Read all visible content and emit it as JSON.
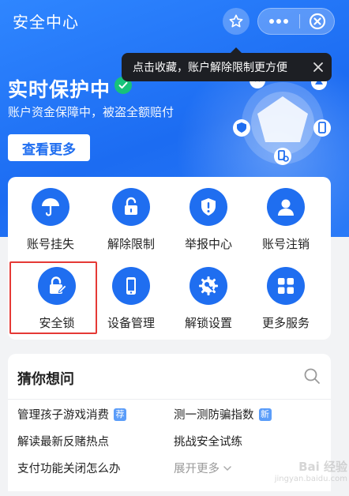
{
  "header": {
    "title": "安全中心",
    "tooltip": "点击收藏，账户解除限制更方便"
  },
  "hero": {
    "title": "实时保护中",
    "subtitle": "账户资金保障中，被盗全额赔付",
    "more_button": "查看更多"
  },
  "grid": [
    {
      "label": "账号挂失",
      "icon": "umbrella-icon"
    },
    {
      "label": "解除限制",
      "icon": "unlock-icon"
    },
    {
      "label": "举报中心",
      "icon": "alert-shield-icon"
    },
    {
      "label": "账号注销",
      "icon": "user-icon"
    },
    {
      "label": "安全锁",
      "icon": "lock-edit-icon"
    },
    {
      "label": "设备管理",
      "icon": "phone-icon"
    },
    {
      "label": "解锁设置",
      "icon": "gear-key-icon"
    },
    {
      "label": "更多服务",
      "icon": "apps-grid-icon"
    }
  ],
  "faq": {
    "title": "猜你想问",
    "items": [
      {
        "text": "管理孩子游戏消费",
        "badge": "荐"
      },
      {
        "text": "测一测防骗指数",
        "badge": "新"
      },
      {
        "text": "解读最新反赌热点"
      },
      {
        "text": "挑战安全试练"
      },
      {
        "text": "支付功能关闭怎么办"
      },
      {
        "text": "展开更多"
      }
    ]
  },
  "watermark": {
    "text": "Bai 经验",
    "url": "jingyan.baidu.com"
  },
  "colors": {
    "primary": "#1f6ef0",
    "hero_bg": "#2a7af7",
    "highlight": "#e53935",
    "check": "#17c27a"
  }
}
